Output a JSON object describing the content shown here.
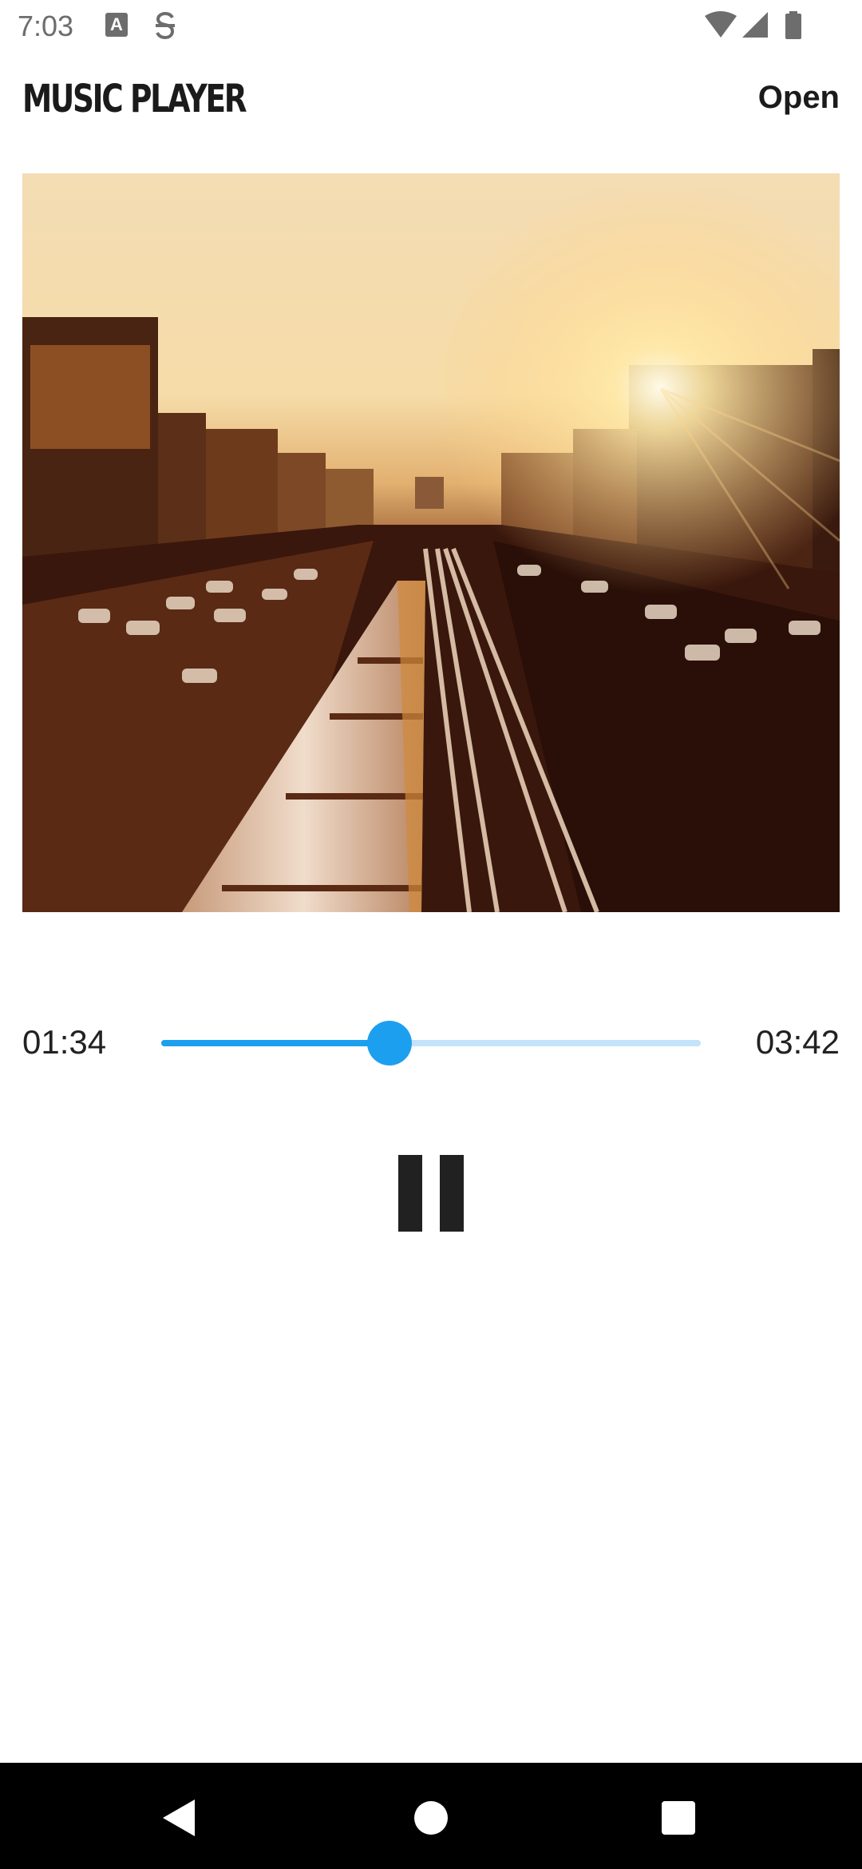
{
  "status_bar": {
    "time": "7:03",
    "icons": [
      "a-notification-icon",
      "s-notification-icon",
      "wifi-icon",
      "signal-icon",
      "battery-icon"
    ]
  },
  "app_bar": {
    "title": "MUSIC PLAYER",
    "open_label": "Open"
  },
  "album_art": {
    "icon": "album-art-image"
  },
  "player": {
    "current_time": "01:34",
    "total_time": "03:42",
    "progress": 0.423,
    "state": "playing",
    "pause_icon": "pause-icon"
  },
  "colors": {
    "accent": "#1d9ff0",
    "track_inactive": "#c3e3fb",
    "text": "#212121",
    "nav_bar": "#000000"
  },
  "nav_bar": {
    "icons": [
      "back-icon",
      "home-icon",
      "recents-icon"
    ]
  }
}
